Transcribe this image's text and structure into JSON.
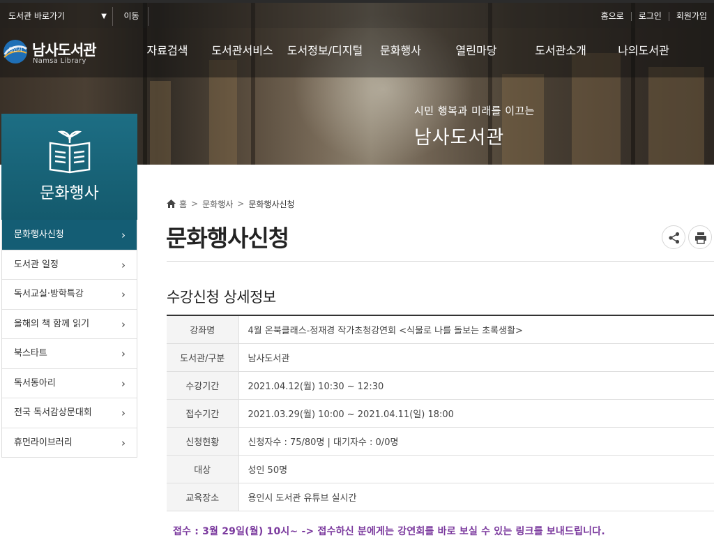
{
  "utility": {
    "shortcut_label": "도서관 바로가기",
    "move_label": "이동",
    "links": [
      "홈으로",
      "로그인",
      "회원가입"
    ]
  },
  "logo": {
    "title": "남사도서관",
    "subtitle": "Namsa Library",
    "mark_text": "용인시"
  },
  "gnb": [
    "자료검색",
    "도서관서비스",
    "도서정보/디지털",
    "문화행사",
    "열린마당",
    "도서관소개",
    "나의도서관"
  ],
  "hero": {
    "subtitle": "시민 행복과 미래를 이끄는",
    "title": "남사도서관"
  },
  "sidebar": {
    "title": "문화행사",
    "items": [
      {
        "label": "문화행사신청",
        "active": true
      },
      {
        "label": "도서관 일정",
        "active": false
      },
      {
        "label": "독서교실·방학특강",
        "active": false
      },
      {
        "label": "올해의 책 함께 읽기",
        "active": false
      },
      {
        "label": "북스타트",
        "active": false
      },
      {
        "label": "독서동아리",
        "active": false
      },
      {
        "label": "전국 독서감상문대회",
        "active": false
      },
      {
        "label": "휴먼라이브러리",
        "active": false
      }
    ]
  },
  "breadcrumb": {
    "home": "홈",
    "items": [
      "문화행사",
      "문화행사신청"
    ]
  },
  "page_title": "문화행사신청",
  "section_title": "수강신청 상세정보",
  "detail_rows": [
    {
      "label": "강좌명",
      "value": "4월 온북클래스-정재경 작가초청강연회 <식물로 나를 돌보는 초록생활>"
    },
    {
      "label": "도서관/구분",
      "value": "남사도서관"
    },
    {
      "label": "수강기간",
      "value": "2021.04.12(월) 10:30 ~ 12:30"
    },
    {
      "label": "접수기간",
      "value": "2021.03.29(월) 10:00 ~ 2021.04.11(일) 18:00"
    },
    {
      "label": "신청현황",
      "value": "신청자수 : 75/80명 | 대기자수 : 0/0명"
    },
    {
      "label": "대상",
      "value": "성인 50명"
    },
    {
      "label": "교육장소",
      "value": "용인시 도서관 유튜브 실시간"
    }
  ],
  "notice": "접수 : 3월 29일(월) 10시~ -> 접수하신 분에게는 강연회를 바로 보실 수 있는 링크를 보내드립니다.",
  "icons": {
    "share": "share-icon",
    "print": "print-icon",
    "home": "home-icon",
    "chevron": "chevron-right-icon"
  },
  "colors": {
    "sidebar_accent": "#145d74",
    "notice_text": "#7b3a9e"
  }
}
